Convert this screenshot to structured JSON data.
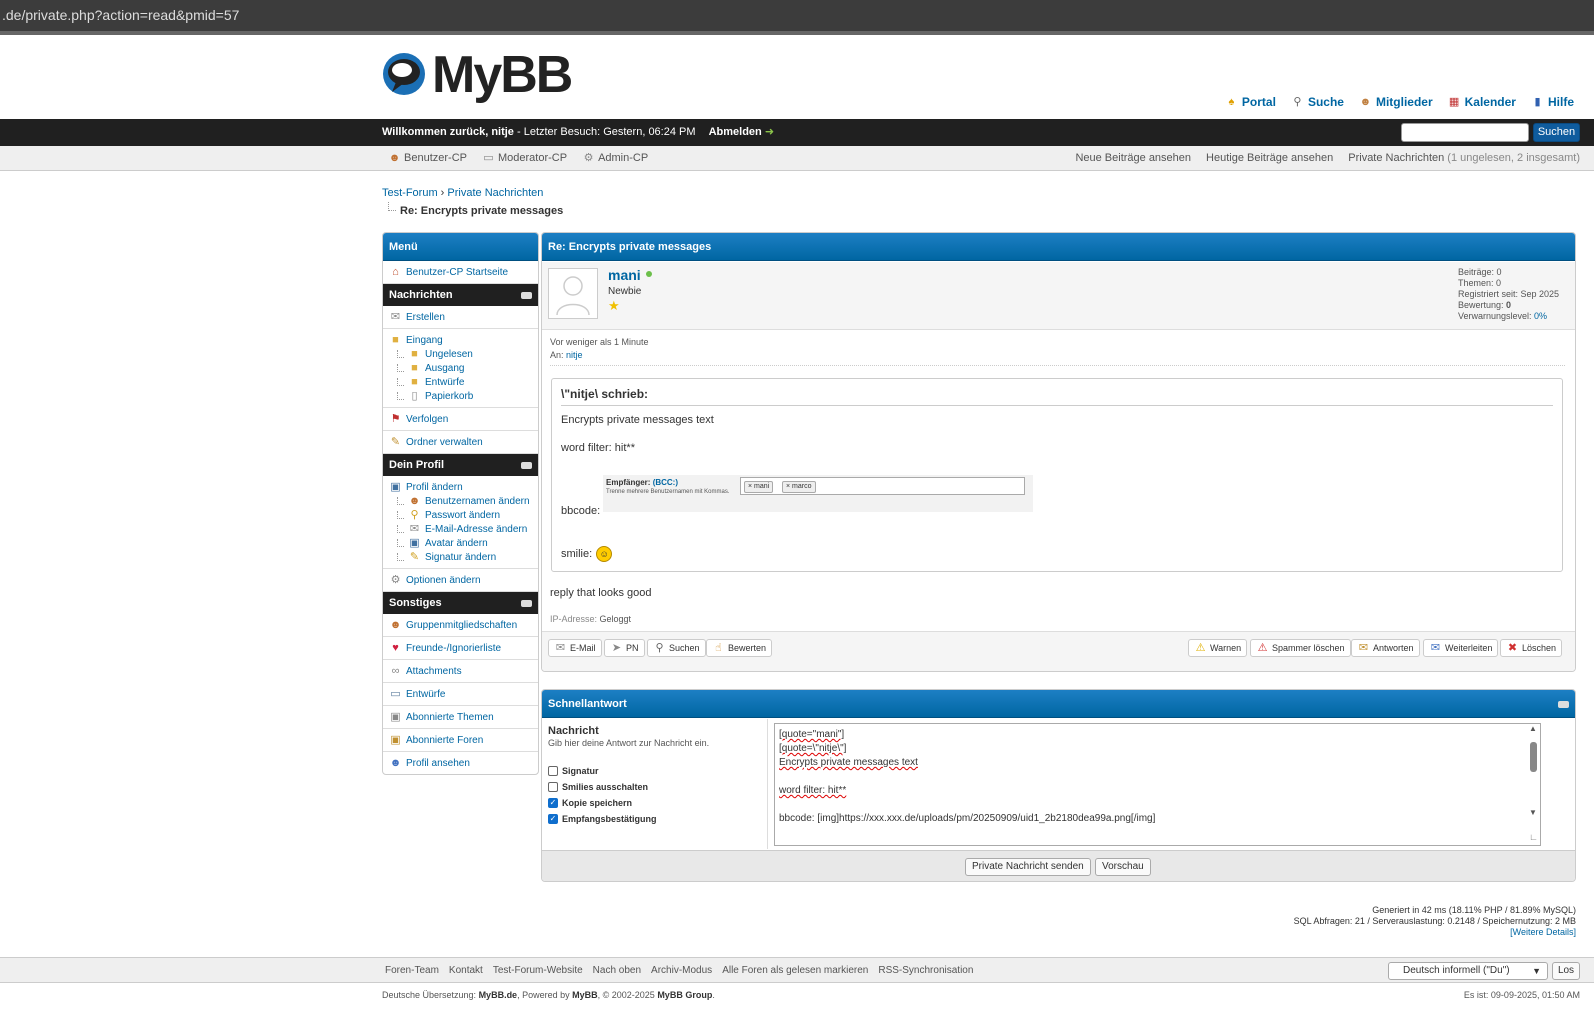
{
  "browser": {
    "url": ".de/private.php?action=read&pmid=57"
  },
  "header": {
    "logo_text": "MyBB",
    "top_links": [
      "Portal",
      "Suche",
      "Mitglieder",
      "Kalender",
      "Hilfe"
    ]
  },
  "welcome": {
    "greeting": "Willkommen zurück, nitje",
    "last_visit": " - Letzter Besuch: Gestern, 06:24 PM",
    "logout": "Abmelden",
    "search_button": "Suchen"
  },
  "panel": {
    "left": [
      "Benutzer-CP",
      "Moderator-CP",
      "Admin-CP"
    ],
    "new_posts": "Neue Beiträge ansehen",
    "today_posts": "Heutige Beiträge ansehen",
    "pm": "Private Nachrichten",
    "pm_count": " (1 ungelesen, 2 insgesamt)"
  },
  "breadcrumb": {
    "forum": "Test-Forum",
    "sep": " › ",
    "pm": "Private Nachrichten",
    "current": "Re: Encrypts private messages"
  },
  "sidebar": {
    "title": "Menü",
    "home": "Benutzer-CP Startseite",
    "cat_messages": "Nachrichten",
    "compose": "Erstellen",
    "inbox": "Eingang",
    "folders": [
      "Ungelesen",
      "Ausgang",
      "Entwürfe",
      "Papierkorb"
    ],
    "track": "Verfolgen",
    "manage_folders": "Ordner verwalten",
    "cat_profile": "Dein Profil",
    "edit_profile": "Profil ändern",
    "profile_sub": [
      "Benutzernamen ändern",
      "Passwort ändern",
      "E-Mail-Adresse ändern",
      "Avatar ändern",
      "Signatur ändern"
    ],
    "options": "Optionen ändern",
    "cat_misc": "Sonstiges",
    "misc": [
      "Gruppenmitgliedschaften",
      "Freunde-/Ignorierliste",
      "Attachments",
      "Entwürfe",
      "Abonnierte Themen",
      "Abonnierte Foren",
      "Profil ansehen"
    ]
  },
  "post": {
    "title": "Re: Encrypts private messages",
    "author": "mani",
    "user_title": "Newbie",
    "stats": [
      "Beiträge: 0",
      "Themen: 0",
      "Registriert seit: Sep 2025"
    ],
    "rating_label": "Bewertung: ",
    "rating_value": "0",
    "warn_label": "Verwarnungslevel: ",
    "warn_value": "0%",
    "time": "Vor weniger als 1 Minute",
    "to_label": "An: ",
    "to_user": "nitje",
    "quote_head": "\\\"nitje\\ schrieb:",
    "quote_line1": "Encrypts private messages text",
    "quote_line2": "word filter: hit**",
    "quote_bbcode": "bbcode:",
    "quote_smilie": "smilie:",
    "img_label": "Empfänger:",
    "img_bcc": "(BCC:)",
    "img_hint": "Trenne mehrere Benutzernamen mit Kommas.",
    "img_chips": [
      "mani",
      "marco"
    ],
    "reply": "reply that looks good",
    "ip_label": "IP-Adresse: ",
    "ip_value": "Geloggt",
    "buttons_left": [
      "E-Mail",
      "PN",
      "Suchen",
      "Bewerten"
    ],
    "buttons_right": [
      "Warnen",
      "Spammer löschen",
      "Antworten",
      "Weiterleiten",
      "Löschen"
    ]
  },
  "quick_reply": {
    "title": "Schnellantwort",
    "label": "Nachricht",
    "desc": "Gib hier deine Antwort zur Nachricht ein.",
    "options": [
      {
        "label": "Signatur",
        "checked": false
      },
      {
        "label": "Smilies ausschalten",
        "checked": false
      },
      {
        "label": "Kopie speichern",
        "checked": true
      },
      {
        "label": "Empfangsbestätigung",
        "checked": true
      }
    ],
    "text_lines": [
      "[quote=\"mani\"]",
      "[quote=\\\"nitje\\\"]",
      "Encrypts private messages text",
      "",
      "word filter: hit**",
      "",
      "bbcode: [img]https://xxx.xxx.de/uploads/pm/20250909/uid1_2b2180dea99a.png[/img]"
    ],
    "send_button": "Private Nachricht senden",
    "preview_button": "Vorschau"
  },
  "debug": {
    "line1": "Generiert in 42 ms (18.11% PHP / 81.89% MySQL)",
    "line2": "SQL Abfragen: 21 / Serverauslastung: 0.2148 / Speichernutzung: 2 MB",
    "details": "[Weitere Details]"
  },
  "footer": {
    "links": [
      "Foren-Team",
      "Kontakt",
      "Test-Forum-Website",
      "Nach oben",
      "Archiv-Modus",
      "Alle Foren als gelesen markieren",
      "RSS-Synchronisation"
    ],
    "language": "Deutsch informell (\"Du\")",
    "go_button": "Los",
    "copyright_pre": "Deutsche Übersetzung: ",
    "copyright_mybbde": "MyBB.de",
    "copyright_mid": ", Powered by ",
    "copyright_mybb": "MyBB",
    "copyright_year": ", © 2002-2025 ",
    "copyright_group": "MyBB Group",
    "copyright_end": ".",
    "time_now": "Es ist: 09-09-2025, 01:50 AM"
  },
  "colors": {
    "accent": "#0066a2",
    "header_bar": "#202020",
    "online": "#6cbf4a"
  }
}
